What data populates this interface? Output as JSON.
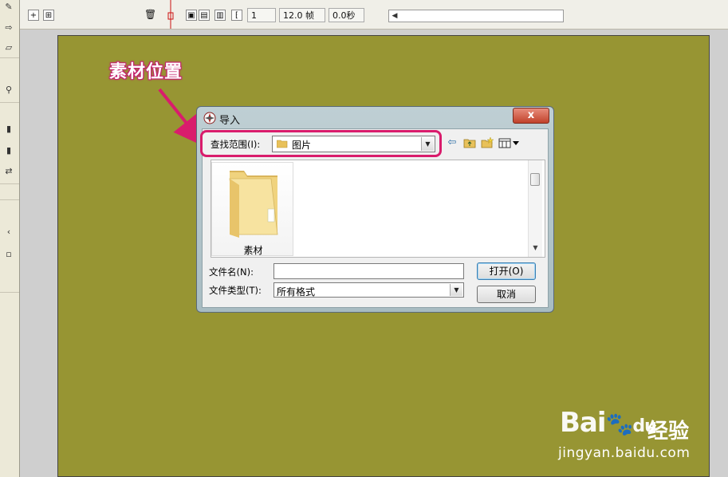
{
  "timeline": {
    "frame_number": "1",
    "frame_rate": "12.0 帧",
    "elapsed_time": "0.0秒"
  },
  "annotation": {
    "text": "素材位置",
    "color": "#d91c6c"
  },
  "dialog": {
    "title": "导入",
    "close_symbol": "x",
    "look_in_label": "查找范围(I):",
    "look_in_value": "图片",
    "items": [
      {
        "name": "素材",
        "icon": "folder-icon"
      }
    ],
    "filename_label": "文件名(N):",
    "filename_value": "",
    "filetype_label": "文件类型(T):",
    "filetype_value": "所有格式",
    "open_button": "打开(O)",
    "cancel_button": "取消"
  },
  "nav_icons": [
    "back-arrow-icon",
    "up-folder-icon",
    "new-folder-icon",
    "view-menu-icon"
  ],
  "colors": {
    "stage": "#979533",
    "highlight": "#d91c6c",
    "toolbar": "#f0efe8"
  },
  "watermark": {
    "logo_text": "Bai",
    "logo_suffix": "du",
    "cn_text": "经验",
    "url": "jingyan.baidu.com"
  }
}
